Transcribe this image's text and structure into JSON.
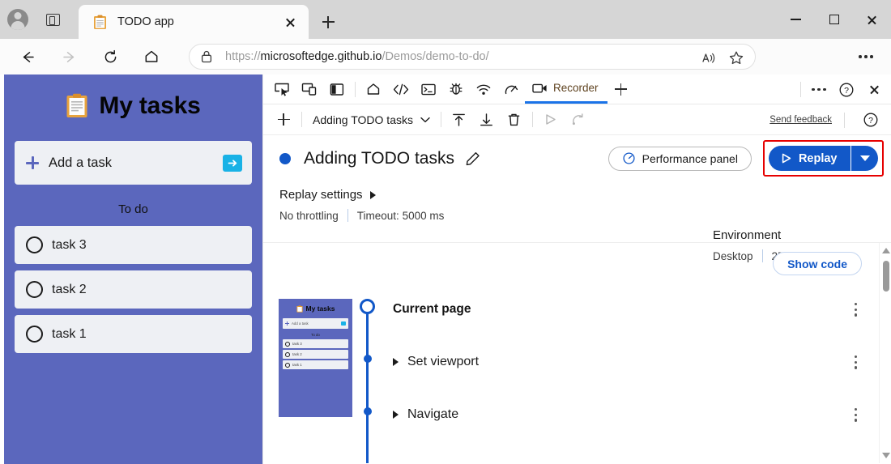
{
  "browser": {
    "profile_icon": "account-avatar-icon",
    "tab_search_icon": "tab-search-icon",
    "tab": {
      "favicon": "clipboard-favicon",
      "title": "TODO app",
      "close_icon": "close-icon"
    },
    "new_tab_icon": "plus-icon",
    "window_controls": {
      "minimize": "minimize-icon",
      "maximize": "maximize-icon",
      "close": "close-icon"
    },
    "nav": {
      "back_icon": "back-arrow-icon",
      "forward_icon": "forward-arrow-icon",
      "refresh_icon": "refresh-icon",
      "home_icon": "home-icon"
    },
    "omnibox": {
      "lock_icon": "lock-icon",
      "url_scheme": "https://",
      "url_domain": "microsoftedge.github.io",
      "url_path": "/Demos/demo-to-do/",
      "read_aloud_icon": "read-aloud-icon",
      "favorite_icon": "star-icon"
    },
    "settings_icon": "ellipsis-icon"
  },
  "todo_app": {
    "header_icon": "clipboard-icon",
    "header_title": "My tasks",
    "add_task": {
      "plus_icon": "plus-icon",
      "label": "Add a task",
      "submit_icon": "arrow-right-icon"
    },
    "section_label": "To do",
    "tasks": [
      {
        "label": "task 3",
        "checkbox_icon": "circle-checkbox-icon"
      },
      {
        "label": "task 2",
        "checkbox_icon": "circle-checkbox-icon"
      },
      {
        "label": "task 1",
        "checkbox_icon": "circle-checkbox-icon"
      }
    ]
  },
  "devtools": {
    "left_icons": [
      {
        "name": "inspect-element-icon"
      },
      {
        "name": "device-emulation-icon"
      },
      {
        "name": "dock-layout-icon"
      }
    ],
    "panel_icons": [
      {
        "name": "welcome-home-icon"
      },
      {
        "name": "elements-icon"
      },
      {
        "name": "console-icon"
      },
      {
        "name": "sources-bug-icon"
      },
      {
        "name": "network-icon"
      },
      {
        "name": "performance-gauge-icon"
      }
    ],
    "active_tab": {
      "icon": "recorder-video-icon",
      "label": "Recorder"
    },
    "add_panel_icon": "plus-icon",
    "more_tools_icon": "ellipsis-icon",
    "help_icon": "help-question-icon",
    "close_icon": "close-icon",
    "subbar": {
      "add_recording_icon": "plus-icon",
      "recording_name": "Adding TODO tasks",
      "recording_chevron_icon": "chevron-down-icon",
      "export_icon": "export-up-arrow-icon",
      "import_icon": "import-down-arrow-icon",
      "delete_icon": "trash-icon",
      "replay_icon": "play-triangle-icon",
      "record_icon": "record-again-icon",
      "send_feedback": "Send feedback",
      "help_icon": "help-question-icon"
    },
    "recording_header": {
      "status_dot": "recording-status-dot",
      "title": "Adding TODO tasks",
      "edit_icon": "pencil-edit-icon",
      "performance_panel": {
        "icon": "performance-gauge-icon",
        "label": "Performance panel"
      },
      "replay_button": {
        "icon": "play-triangle-icon",
        "label": "Replay",
        "dropdown_icon": "chevron-down-icon",
        "highlight_color": "#e60000",
        "accent_color": "#1258c8"
      }
    },
    "replay_settings": {
      "title": "Replay settings",
      "expander_icon": "triangle-right-icon",
      "throttling": "No throttling",
      "timeout": "Timeout: 5000 ms"
    },
    "environment": {
      "title": "Environment",
      "device": "Desktop",
      "viewport": "252×587 px"
    },
    "steps_panel": {
      "show_code_label": "Show code",
      "thumbnail": {
        "header_icon": "clipboard-icon",
        "title": "My tasks",
        "add_label": "Add a task",
        "section_label": "To do",
        "tasks": [
          "task 3",
          "task 2",
          "task 1"
        ]
      },
      "steps": [
        {
          "label": "Current page",
          "type": "current",
          "menu_icon": "kebab-menu-icon"
        },
        {
          "label": "Set viewport",
          "type": "step",
          "expander_icon": "triangle-right-icon",
          "menu_icon": "kebab-menu-icon"
        },
        {
          "label": "Navigate",
          "type": "step",
          "expander_icon": "triangle-right-icon",
          "menu_icon": "kebab-menu-icon"
        }
      ],
      "scrollbar": {
        "up_icon": "scroll-up-arrow-icon",
        "down_icon": "scroll-down-arrow-icon"
      }
    }
  }
}
